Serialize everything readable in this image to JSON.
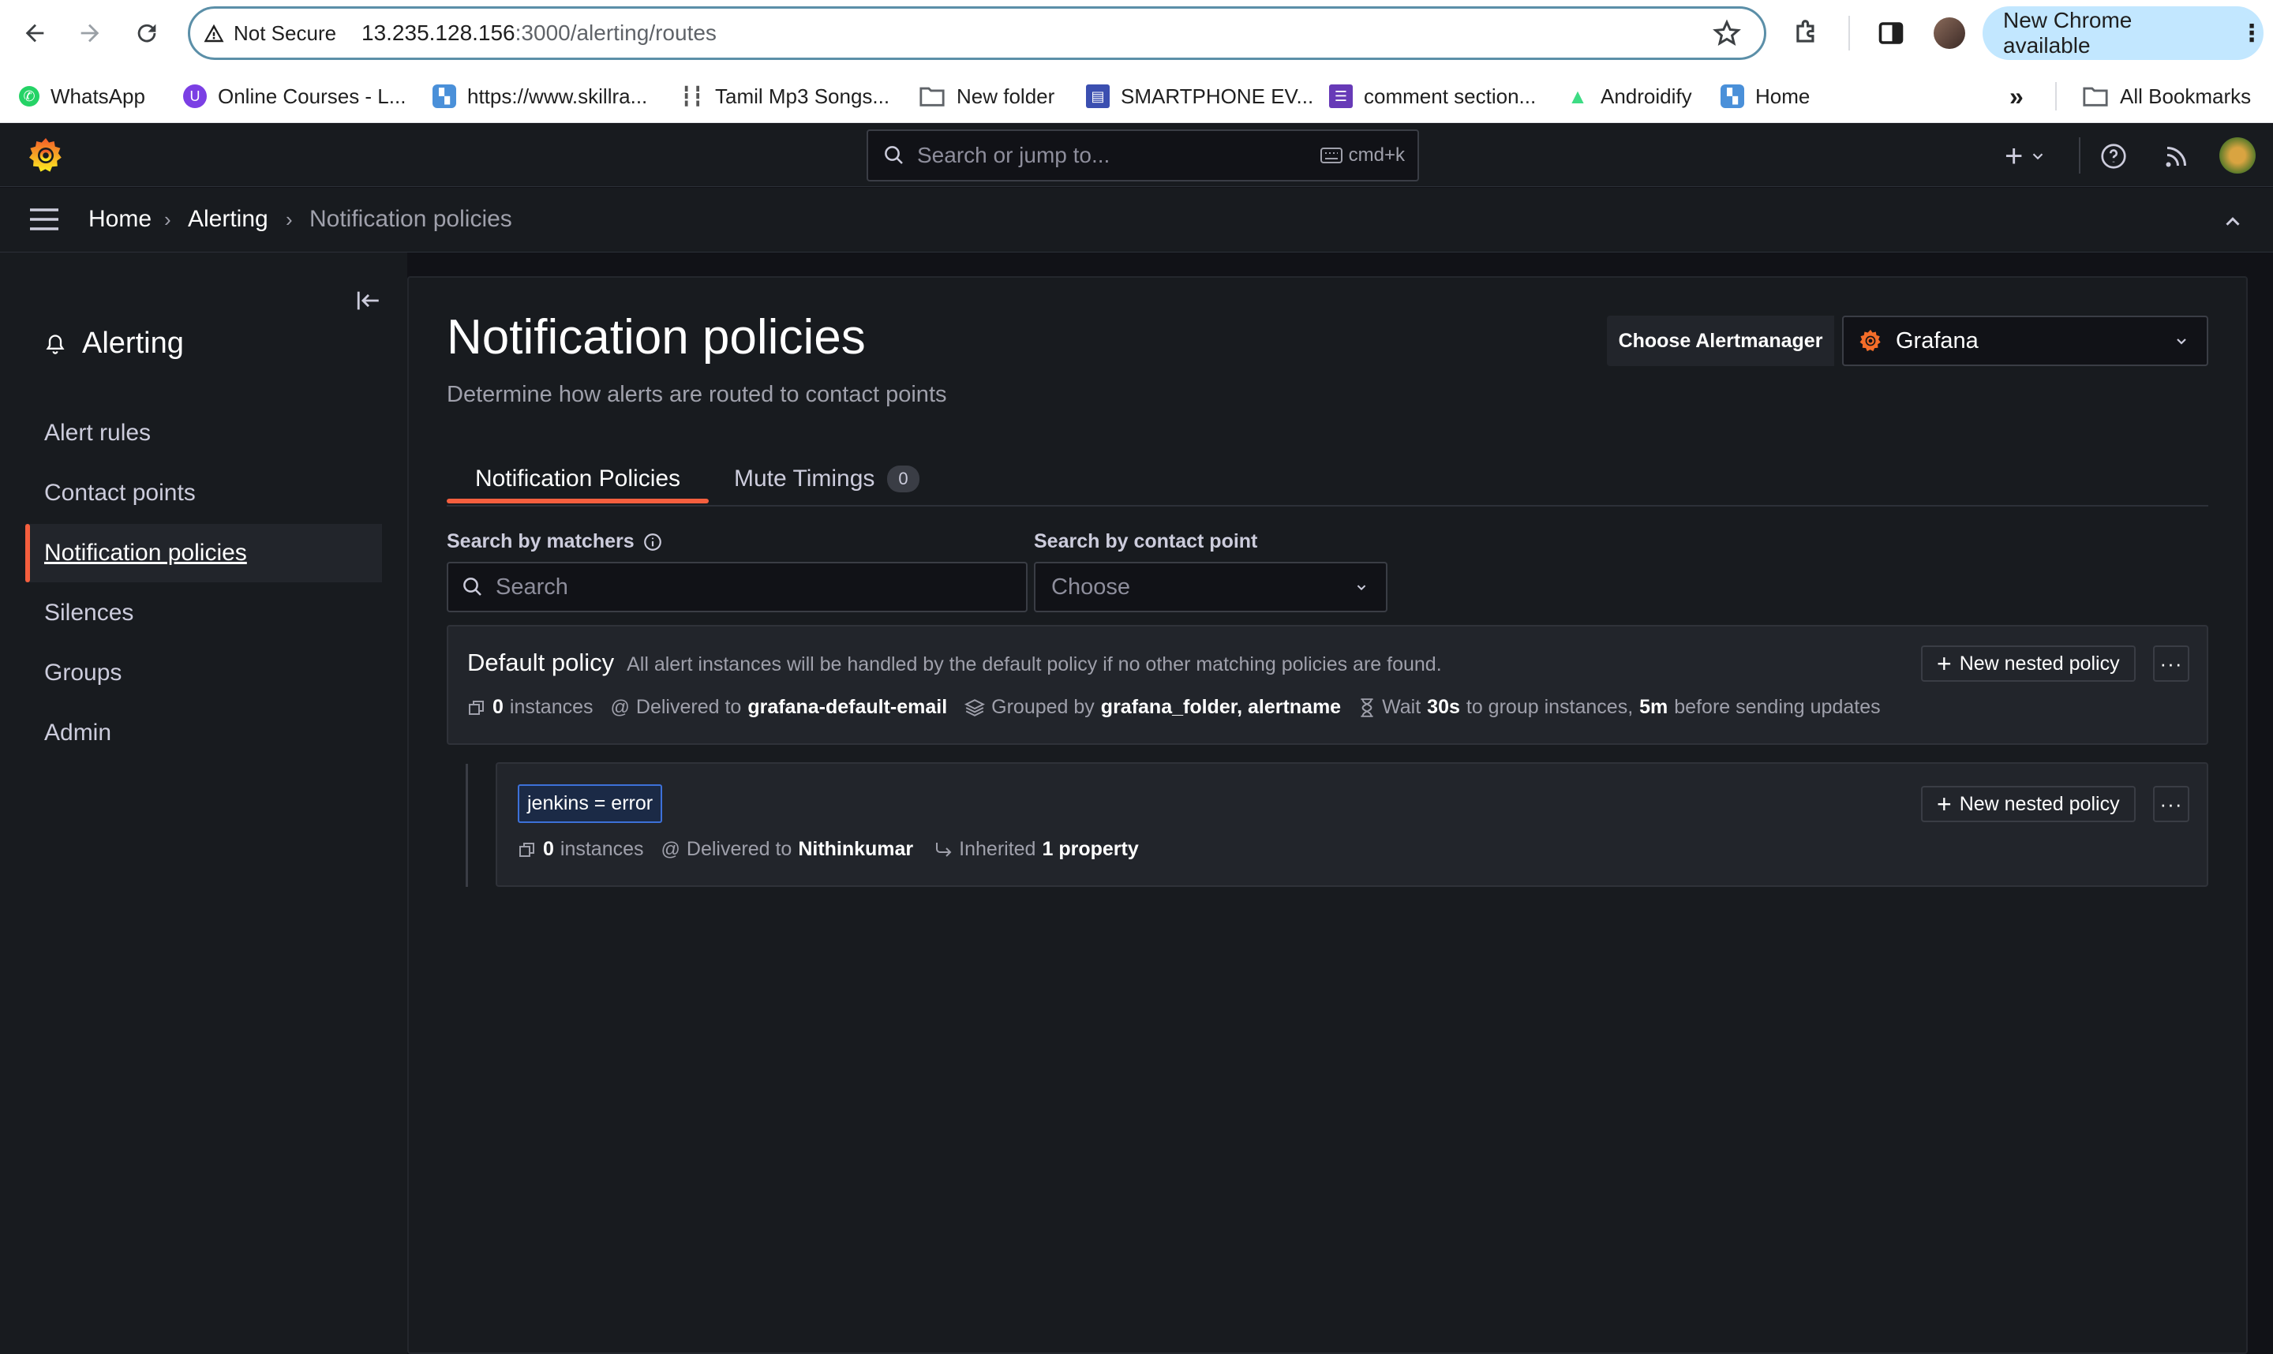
{
  "browser": {
    "not_secure_label": "Not Secure",
    "url_host": "13.235.128.156",
    "url_path": ":3000/alerting/routes",
    "update_label": "New Chrome available",
    "bookmarks": [
      {
        "label": "WhatsApp",
        "icon": "whatsapp-icon",
        "color": "#25d366"
      },
      {
        "label": "Online Courses - L...",
        "icon": "courses-icon",
        "color": "#7b3fe4"
      },
      {
        "label": "https://www.skillra...",
        "icon": "skillrack-icon",
        "color": "#4a90d9"
      },
      {
        "label": "Tamil Mp3 Songs...",
        "icon": "music-icon",
        "color": "#555555"
      },
      {
        "label": "New folder",
        "icon": "folder-icon",
        "color": "#5f6368"
      },
      {
        "label": "SMARTPHONE EV...",
        "icon": "form-icon",
        "color": "#3b4fb0"
      },
      {
        "label": "comment section...",
        "icon": "list-icon",
        "color": "#673ab7"
      },
      {
        "label": "Androidify",
        "icon": "android-icon",
        "color": "#3ddc84"
      },
      {
        "label": "Home",
        "icon": "home-bookmark-icon",
        "color": "#4a90d9"
      }
    ],
    "all_bookmarks_label": "All Bookmarks"
  },
  "topbar": {
    "search_placeholder": "Search or jump to...",
    "search_shortcut": "cmd+k"
  },
  "breadcrumbs": [
    "Home",
    "Alerting",
    "Notification policies"
  ],
  "sidebar": {
    "section_title": "Alerting",
    "items": [
      {
        "label": "Alert rules",
        "active": false
      },
      {
        "label": "Contact points",
        "active": false
      },
      {
        "label": "Notification policies",
        "active": true
      },
      {
        "label": "Silences",
        "active": false
      },
      {
        "label": "Groups",
        "active": false
      },
      {
        "label": "Admin",
        "active": false
      }
    ]
  },
  "page": {
    "title": "Notification policies",
    "subtitle": "Determine how alerts are routed to contact points",
    "alertmanager_label": "Choose Alertmanager",
    "alertmanager_value": "Grafana",
    "tabs": [
      {
        "label": "Notification Policies",
        "active": true
      },
      {
        "label": "Mute Timings",
        "count": "0"
      }
    ],
    "filters": {
      "matchers_label": "Search by matchers",
      "matchers_placeholder": "Search",
      "contact_label": "Search by contact point",
      "contact_placeholder": "Choose"
    }
  },
  "default_policy": {
    "title": "Default policy",
    "description": "All alert instances will be handled by the default policy if no other matching policies are found.",
    "new_nested_label": "New nested policy",
    "instances_count": "0",
    "instances_label": "instances",
    "delivered_label": "Delivered to",
    "delivered_value": "grafana-default-email",
    "grouped_label": "Grouped by",
    "grouped_value": "grafana_folder, alertname",
    "wait_label": "Wait",
    "wait_value": "30s",
    "wait_suffix": "to group instances,",
    "repeat_value": "5m",
    "repeat_suffix": "before sending updates"
  },
  "nested_policy": {
    "matcher": "jenkins = error",
    "new_nested_label": "New nested policy",
    "instances_count": "0",
    "instances_label": "instances",
    "delivered_label": "Delivered to",
    "delivered_value": "Nithinkumar",
    "inherited_label": "Inherited",
    "inherited_value": "1 property"
  },
  "colors": {
    "accent": "#f55f3e",
    "background": "#111217",
    "panel": "#181b1f",
    "matcher_border": "#3d71d9"
  }
}
